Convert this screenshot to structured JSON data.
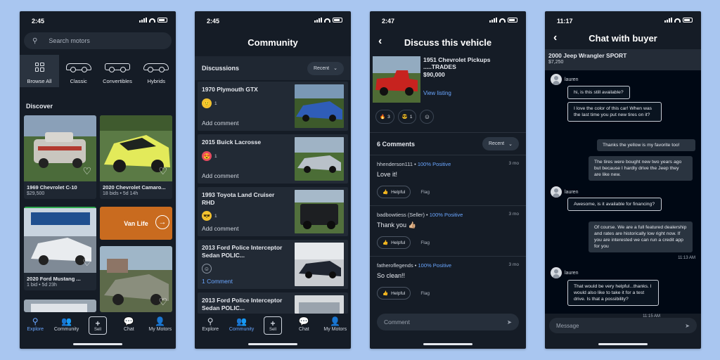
{
  "phone1": {
    "time": "2:45",
    "search_placeholder": "Search motors",
    "categories": [
      {
        "label": "Browse All",
        "icon": "grid-icon"
      },
      {
        "label": "Classic",
        "icon": "classic-car-icon"
      },
      {
        "label": "Convertibles",
        "icon": "convertible-car-icon"
      },
      {
        "label": "Hybrids",
        "icon": "hybrid-car-icon"
      }
    ],
    "discover_title": "Discover",
    "listings": [
      {
        "title": "1969 Chevrolet C-10",
        "sub": "$29,500"
      },
      {
        "title": "2020 Chevrolet Camaro...",
        "sub": "18 bids • 5d 14h"
      },
      {
        "title": "2020 Ford Mustang ...",
        "sub": "1 bid • 5d 23h"
      }
    ],
    "promo_label": "Van Life",
    "tabs": [
      {
        "label": "Explore",
        "icon": "search-icon"
      },
      {
        "label": "Community",
        "icon": "community-icon"
      },
      {
        "label": "Sell",
        "icon": "plus-icon"
      },
      {
        "label": "Chat",
        "icon": "chat-icon"
      },
      {
        "label": "My Motors",
        "icon": "person-icon"
      }
    ]
  },
  "phone2": {
    "time": "2:45",
    "title": "Community",
    "section": "Discussions",
    "sort": "Recent",
    "threads": [
      {
        "title": "1970 Plymouth GTX",
        "count": "1",
        "action": "Add comment"
      },
      {
        "title": "2015 Buick Lacrosse",
        "count": "1",
        "action": "Add comment"
      },
      {
        "title": "1993 Toyota Land Cruiser RHD",
        "count": "1",
        "action": "Add comment"
      },
      {
        "title": "2013 Ford Police Interceptor Sedan POLIC...",
        "count": "",
        "action": "1 Comment"
      },
      {
        "title": "2013 Ford Police Interceptor Sedan POLIC...",
        "count": "",
        "action": ""
      }
    ]
  },
  "phone3": {
    "time": "2:47",
    "title": "Discuss this vehicle",
    "vehicle_title": "1951 Chevrolet Pickups .....TRADES",
    "vehicle_price": "$90,000",
    "view_listing": "View listing",
    "reactions": [
      {
        "emoji": "🔥",
        "count": "3"
      },
      {
        "emoji": "😎",
        "count": "1"
      }
    ],
    "comments_title": "6 Comments",
    "sort": "Recent",
    "comments": [
      {
        "user": "hhenderson111",
        "rating": "100% Positive",
        "when": "3 mo",
        "text": "Love it!"
      },
      {
        "user": "badbowtiess (Seller)",
        "rating": "100% Positive",
        "when": "3 mo",
        "text": "Thank you 👍🏼"
      },
      {
        "user": "fatheroflegends",
        "rating": "100% Positive",
        "when": "3 mo",
        "text": "So clean!!"
      }
    ],
    "helpful": "Helpful",
    "flag": "Flag",
    "comment_placeholder": "Comment"
  },
  "phone4": {
    "time": "11:17",
    "title": "Chat with buyer",
    "deal_title": "2000 Jeep Wrangler SPORT",
    "deal_price": "$7,250",
    "buyer": "lauren",
    "messages": [
      {
        "text": "hi, is this still available?"
      },
      {
        "text": "I love the color of this car! When was the last time you put new tires on it?"
      },
      {
        "text": "Thanks the yellow is my favorite too!"
      },
      {
        "text": "The tires were bought new two years ago but because I hardly drive the Jeep they are like new."
      },
      {
        "text": "Awesome, is it available for financing?"
      },
      {
        "text": "Of course. We are a full featured dealership and rates are historically low right now. If you are interested we can run a credit app for you"
      },
      {
        "text": "That would be very helpful...thanks. I would also like to take it for a test drive. Is that a possibility?"
      }
    ],
    "stamp1": "11:13 AM",
    "stamp2": "11:15 AM",
    "message_placeholder": "Message"
  }
}
